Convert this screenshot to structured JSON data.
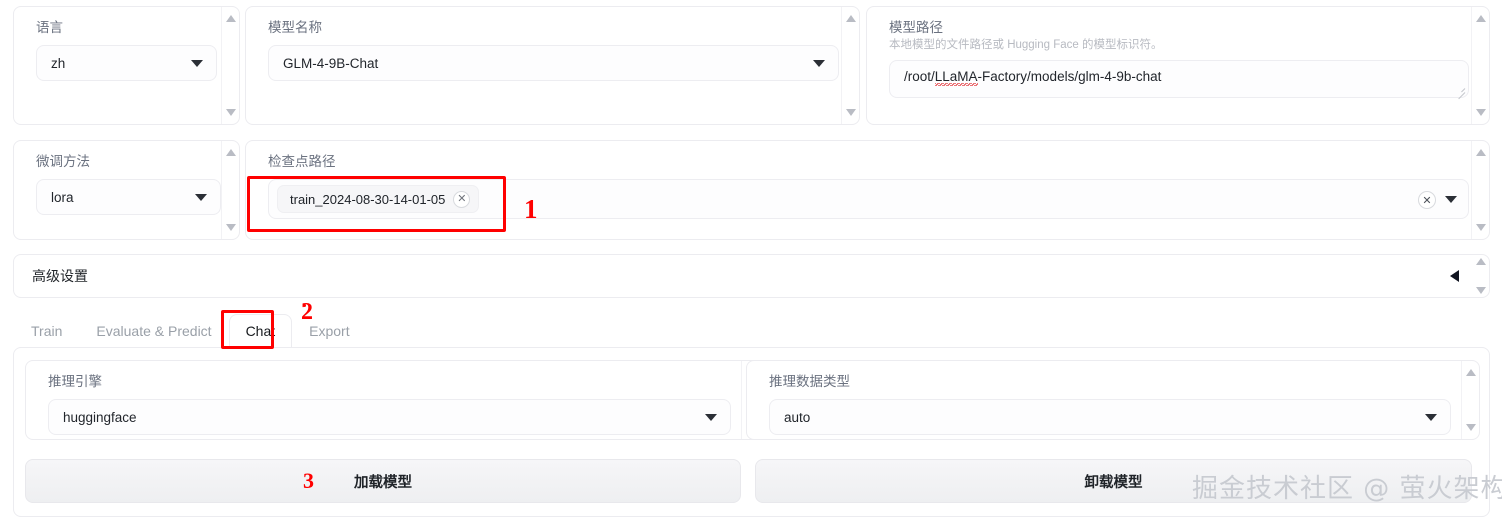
{
  "language_panel": {
    "label": "语言",
    "value": "zh",
    "caret_icon": "chevron-down-icon"
  },
  "model_name_panel": {
    "label": "模型名称",
    "value": "GLM-4-9B-Chat",
    "caret_icon": "chevron-down-icon"
  },
  "model_path_panel": {
    "label": "模型路径",
    "description": "本地模型的文件路径或 Hugging Face 的模型标识符。",
    "value_prefix": "/root/",
    "value_misspelled": "LLaMA",
    "value_suffix": "-Factory/models/glm-4-9b-chat",
    "full_value": "/root/LLaMA-Factory/models/glm-4-9b-chat"
  },
  "finetune_panel": {
    "label": "微调方法",
    "value": "lora",
    "caret_icon": "chevron-down-icon"
  },
  "checkpoint_panel": {
    "label": "检查点路径",
    "tokens": [
      {
        "label": "train_2024-08-30-14-01-05",
        "remove_icon": "close-icon"
      }
    ],
    "clear_icon": "close-icon",
    "caret_icon": "chevron-down-icon"
  },
  "advanced_settings": {
    "title": "高级设置",
    "caret_icon": "chevron-left-icon"
  },
  "tabs": [
    {
      "label": "Train",
      "active": false
    },
    {
      "label": "Evaluate & Predict",
      "active": false
    },
    {
      "label": "Chat",
      "active": true
    },
    {
      "label": "Export",
      "active": false
    }
  ],
  "inference_engine": {
    "label": "推理引擎",
    "value": "huggingface",
    "caret_icon": "chevron-down-icon"
  },
  "inference_dtype": {
    "label": "推理数据类型",
    "value": "auto",
    "caret_icon": "chevron-down-icon"
  },
  "buttons": {
    "load_model": "加载模型",
    "unload_model": "卸载模型"
  },
  "annotations": [
    {
      "number": "1"
    },
    {
      "number": "2"
    },
    {
      "number": "3"
    }
  ],
  "watermark": {
    "text": "掘金技术社区 @ 萤火架构"
  },
  "colors": {
    "annotation_red": "#ff0000",
    "panel_border": "#ececf0",
    "label_gray": "#6b7280",
    "text": "#1f2328",
    "watermark_gray": "#c9ccd2"
  }
}
